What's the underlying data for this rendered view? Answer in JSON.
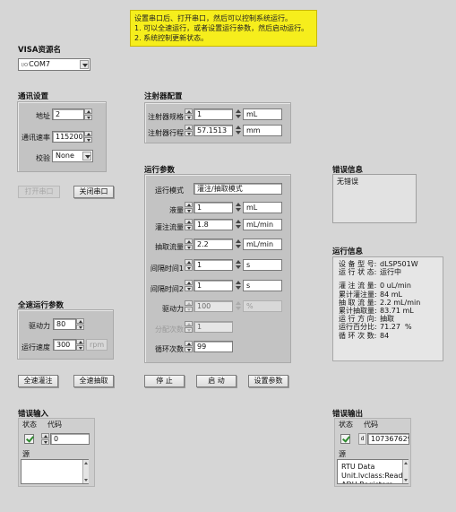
{
  "instructions": {
    "line1": "设置串口后、打开串口，然后可以控制系统运行。",
    "line2": "1. 可以全速运行，或者设置运行参数，然后启动运行。",
    "line3": "2. 系统控制更新状态。"
  },
  "visa": {
    "label": "VISA资源名",
    "icon_text": "I/O",
    "value": "COM7"
  },
  "comm": {
    "header": "通讯设置",
    "address_label": "地址",
    "address_value": "2",
    "baud_label": "通讯速率",
    "baud_value": "115200",
    "parity_label": "校验",
    "parity_value": "None",
    "open_port": "打开串口",
    "close_port": "关闭串口"
  },
  "syringe": {
    "header": "注射器配置",
    "spec_label": "注射器规格",
    "spec_value": "1",
    "spec_unit": "mL",
    "stroke_label": "注射器行程",
    "stroke_value": "57.1513",
    "stroke_unit": "mm"
  },
  "run_params": {
    "header": "运行参数",
    "mode_label": "运行模式",
    "mode_value": "灌注/抽取模式",
    "volume_label": "液量",
    "volume_value": "1",
    "volume_unit": "mL",
    "infuse_rate_label": "灌注流量",
    "infuse_rate_value": "1.8",
    "infuse_rate_unit": "mL/min",
    "withdraw_rate_label": "抽取流量",
    "withdraw_rate_value": "2.2",
    "withdraw_rate_unit": "mL/min",
    "interval1_label": "间隔时间1",
    "interval1_value": "1",
    "interval1_unit": "s",
    "interval2_label": "间隔时间2",
    "interval2_value": "1",
    "interval2_unit": "s",
    "force_label": "驱动力",
    "force_value": "100",
    "force_unit": "%",
    "split_label": "分配次数",
    "split_value": "1",
    "cycles_label": "循环次数",
    "cycles_value": "99",
    "stop": "停 止",
    "start": "启 动",
    "set_params": "设置参数"
  },
  "fullspeed": {
    "header": "全速运行参数",
    "force_label": "驱动力",
    "force_value": "80",
    "speed_label": "运行速度",
    "speed_value": "300",
    "speed_unit": "rpm",
    "full_infuse": "全速灌注",
    "full_withdraw": "全速抽取"
  },
  "error_info": {
    "header": "错误信息",
    "text": "无错误"
  },
  "run_info": {
    "header": "运行信息",
    "rows": [
      {
        "k": "设 备 型 号:",
        "v": "dLSP501W"
      },
      {
        "k": "运 行 状 态:",
        "v": "运行中"
      },
      {
        "k": "",
        "v": ""
      },
      {
        "k": "灌 注 流 量:",
        "v": "0 uL/min"
      },
      {
        "k": "累计灌注量:",
        "v": "84 mL"
      },
      {
        "k": "抽 取 流 量:",
        "v": "2.2 mL/min"
      },
      {
        "k": "累计抽取量:",
        "v": "83.71 mL"
      },
      {
        "k": "运 行 方 向:",
        "v": "抽取"
      },
      {
        "k": "运行百分比:",
        "v": "71.27  %"
      },
      {
        "k": "循 环 次 数:",
        "v": "84"
      }
    ]
  },
  "error_in": {
    "header": "错误输入",
    "status_label": "状态",
    "code_label": "代码",
    "code_value": "0",
    "source_label": "源",
    "source_value": ""
  },
  "error_out": {
    "header": "错误输出",
    "status_label": "状态",
    "code_label": "代码",
    "code_value": "107367629",
    "source_label": "源",
    "source_value": "RTU Data\nUnit.lvclass:Read\nADH Registers..."
  },
  "colors": {
    "note_bg": "#f6ee1c",
    "panel_bg": "#c3c3c3",
    "check_green": "#2e8b2e"
  }
}
